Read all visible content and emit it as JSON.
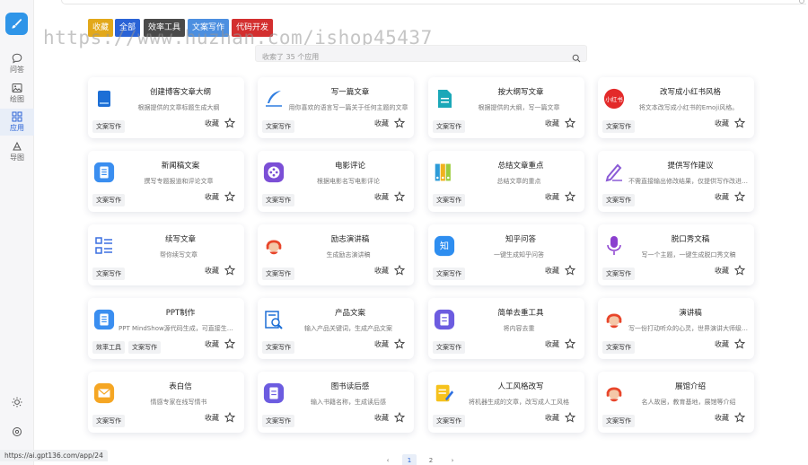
{
  "sidebar": {
    "items": [
      {
        "label": "问答",
        "icon": "chat-icon"
      },
      {
        "label": "绘图",
        "icon": "image-icon"
      },
      {
        "label": "应用",
        "icon": "apps-icon"
      },
      {
        "label": "导图",
        "icon": "mindmap-icon"
      }
    ],
    "bottom": [
      {
        "icon": "sun-icon"
      },
      {
        "icon": "settings-icon"
      }
    ]
  },
  "tags": [
    {
      "label": "收藏",
      "color": "#e2a81a"
    },
    {
      "label": "全部",
      "color": "#2a63d6"
    },
    {
      "label": "效率工具",
      "color": "#4a4a4a"
    },
    {
      "label": "文案写作",
      "color": "#4c8fe0"
    },
    {
      "label": "代码开发",
      "color": "#d32f2f"
    }
  ],
  "watermark": "https://www.huzhan.com/ishop45437",
  "search": {
    "placeholder": "收索了 35 个应用"
  },
  "fav_label": "收藏",
  "cards": [
    {
      "title": "创建博客文章大纲",
      "desc": "根据提供的文章标题生成大纲",
      "chips": [
        "文案写作"
      ],
      "icon": "book-icon"
    },
    {
      "title": "写一篇文章",
      "desc": "用你喜欢的语言写一篇关于任何主题的文章",
      "chips": [
        "文案写作"
      ],
      "icon": "quill-icon"
    },
    {
      "title": "按大纲写文章",
      "desc": "根据提供的大纲，写一篇文章",
      "chips": [
        "文案写作"
      ],
      "icon": "document-icon"
    },
    {
      "title": "改写成小红书风格",
      "desc": "将文本改写成小红书的Emoji风格。",
      "chips": [
        "文案写作"
      ],
      "icon": "xiaohongshu-icon"
    },
    {
      "title": "新闻稿文案",
      "desc": "撰写专题报道和评论文章",
      "chips": [
        "文案写作"
      ],
      "icon": "news-icon"
    },
    {
      "title": "电影评论",
      "desc": "根据电影名写电影评论",
      "chips": [
        "文案写作"
      ],
      "icon": "film-reel-icon"
    },
    {
      "title": "总结文章重点",
      "desc": "总结文章的重点",
      "chips": [
        "文案写作"
      ],
      "icon": "binders-icon"
    },
    {
      "title": "提供写作建议",
      "desc": "不需直接输出修改结果，仅提供写作改进建议",
      "chips": [
        "文案写作"
      ],
      "icon": "pen-icon"
    },
    {
      "title": "续写文章",
      "desc": "帮你续写文章",
      "chips": [
        "文案写作"
      ],
      "icon": "list-icon"
    },
    {
      "title": "励志演讲稿",
      "desc": "生成励志演讲稿",
      "chips": [
        "文案写作"
      ],
      "icon": "headset-icon"
    },
    {
      "title": "知乎问答",
      "desc": "一键生成知乎问答",
      "chips": [
        "文案写作"
      ],
      "icon": "zhihu-icon"
    },
    {
      "title": "脱口秀文稿",
      "desc": "写一个主题，一键生成脱口秀文稿",
      "chips": [
        "文案写作"
      ],
      "icon": "microphone-icon"
    },
    {
      "title": "PPT制作",
      "desc": "PPT MindShow源代码生成，可直接生成PPT",
      "chips": [
        "效率工具",
        "文案写作"
      ],
      "icon": "ppt-icon"
    },
    {
      "title": "产品文案",
      "desc": "输入产品关键词，生成产品文案",
      "chips": [
        "文案写作"
      ],
      "icon": "magnifier-doc-icon"
    },
    {
      "title": "简单去重工具",
      "desc": "将内容去重",
      "chips": [
        "文案写作"
      ],
      "icon": "dedupe-icon"
    },
    {
      "title": "演讲稿",
      "desc": "写一份打动听众的心灵，世界演讲大师级的演讲稿",
      "chips": [
        "文案写作"
      ],
      "icon": "speech-headset-icon"
    },
    {
      "title": "表白信",
      "desc": "情感专家在线写情书",
      "chips": [
        "文案写作"
      ],
      "icon": "envelope-icon"
    },
    {
      "title": "图书读后感",
      "desc": "输入书籍名称，生成读后感",
      "chips": [
        "文案写作"
      ],
      "icon": "book-review-icon"
    },
    {
      "title": "人工风格改写",
      "desc": "将机器生成的文章，改写成人工风格",
      "chips": [
        "文案写作"
      ],
      "icon": "rewrite-icon"
    },
    {
      "title": "展馆介绍",
      "desc": "名人故居，教育基地，展馆等介绍",
      "chips": [
        "文案写作"
      ],
      "icon": "guide-headset-icon"
    }
  ],
  "status_url": "https://ai.gpt136.com/app/24",
  "pagination": {
    "prev": "‹",
    "pages": [
      "1",
      "2"
    ],
    "next": "›"
  }
}
